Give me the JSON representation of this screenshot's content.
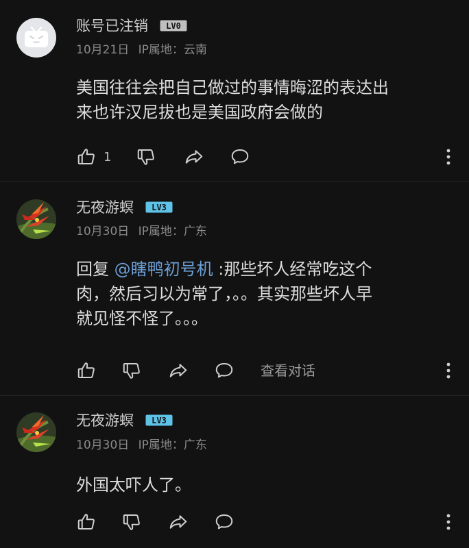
{
  "comments": [
    {
      "username": "账号已注销",
      "level": "LV0",
      "date": "10月21日",
      "ip_location": "IP属地：云南",
      "content_lines": [
        "美国往往会把自己做过的事情晦涩的表达出",
        "来也许汉尼拔也是美国政府会做的"
      ],
      "like_count": "1",
      "avatar_icon": "deleted-account-tv-avatar"
    },
    {
      "username": "无夜游螟",
      "level": "LV3",
      "date": "10月30日",
      "ip_location": "IP属地：广东",
      "reply_prefix": "回复 ",
      "mention": "@瞎鸭初号机",
      "content_lines": [
        " :那些坏人经常吃这个",
        "肉，然后习以为常了，。。其实那些坏人早",
        "就见怪不怪了。。。"
      ],
      "view_thread_label": "查看对话",
      "avatar_icon": "bird-of-paradise-flower-avatar"
    },
    {
      "username": "无夜游螟",
      "level": "LV3",
      "date": "10月30日",
      "ip_location": "IP属地：广东",
      "content_lines": [
        "外国太吓人了。"
      ],
      "avatar_icon": "bird-of-paradise-flower-avatar"
    }
  ],
  "colors": {
    "background": "#121212",
    "level_lv0": "#bfbfbf",
    "level_lv3": "#5fc3e8",
    "mention": "#6d9fd6"
  }
}
